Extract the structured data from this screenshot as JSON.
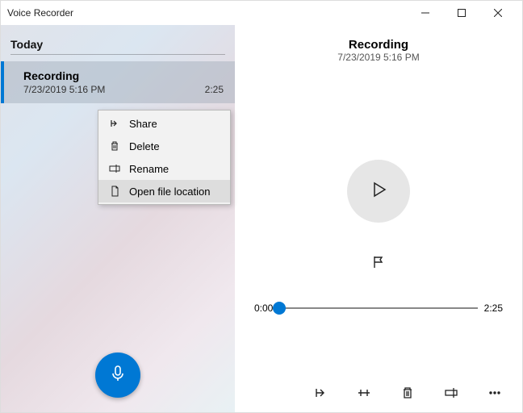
{
  "window": {
    "title": "Voice Recorder"
  },
  "left": {
    "section": "Today",
    "item": {
      "title": "Recording",
      "datetime": "7/23/2019 5:16 PM",
      "duration": "2:25"
    }
  },
  "context_menu": {
    "share": "Share",
    "delete": "Delete",
    "rename": "Rename",
    "open_location": "Open file location"
  },
  "right": {
    "title": "Recording",
    "datetime": "7/23/2019 5:16 PM",
    "time_start": "0:00",
    "time_end": "2:25"
  }
}
